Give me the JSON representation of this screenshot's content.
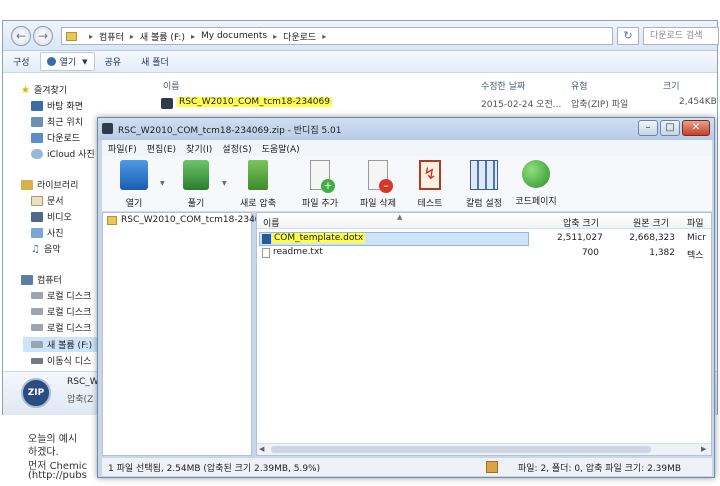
{
  "explorer": {
    "address": {
      "segments": [
        "컴퓨터",
        "새 볼륨 (F:)",
        "My documents",
        "다운로드"
      ]
    },
    "search_placeholder": "다운로드 검색",
    "toolbar": {
      "organize": "구성",
      "open": "열기",
      "share": "공유",
      "new_folder": "새 폴더"
    },
    "sidebar": {
      "favorites": "즐겨찾기",
      "fav_items": [
        "바탕 화면",
        "최근 위치",
        "다운로드",
        "iCloud 사진"
      ],
      "libraries": "라이브러리",
      "lib_items": [
        "문서",
        "비디오",
        "사진",
        "음악"
      ],
      "computer": "컴퓨터",
      "comp_items": [
        "로컬 디스크",
        "로컬 디스크",
        "로컬 디스크",
        "새 볼륨 (F:)",
        "이동식 디스"
      ]
    },
    "columns": {
      "name": "이름",
      "modified": "수정한 날짜",
      "type": "유형",
      "size": "크기"
    },
    "file": {
      "name": "RSC_W2010_COM_tcm18-234069",
      "modified": "2015-02-24 오전...",
      "type": "압축(ZIP) 파일",
      "size": "2,454KB"
    },
    "status": {
      "name": "RSC_W",
      "type": "압축(Z"
    }
  },
  "bandizip": {
    "title": "RSC_W2010_COM_tcm18-234069.zip - 반디집 5.01",
    "menu": [
      "파일(F)",
      "편집(E)",
      "찾기(I)",
      "설정(S)",
      "도움말(A)"
    ],
    "tools": [
      "열기",
      "풀기",
      "새로 압축",
      "파일 추가",
      "파일 삭제",
      "테스트",
      "칼럼 설정",
      "코드페이지"
    ],
    "tree_root": "RSC_W2010_COM_tcm18-2340",
    "list_columns": {
      "name": "이름",
      "packed": "압축 크기",
      "original": "원본 크기",
      "type": "파일"
    },
    "rows": [
      {
        "name": "COM_template.dotx",
        "packed": "2,511,027",
        "original": "2,668,323",
        "type": "Micr"
      },
      {
        "name": "readme.txt",
        "packed": "700",
        "original": "1,382",
        "type": "텍스"
      }
    ],
    "status_left": "1 파일 선택됨, 2.54MB (압축된 크기 2.39MB, 5.9%)",
    "status_right": "파일: 2, 폴더: 0, 압축 파일 크기: 2.39MB"
  },
  "document": {
    "lines": [
      "오늘의 예시",
      "하겠다.",
      "먼저 Chemic",
      "(http://pubs"
    ]
  },
  "colors": {
    "highlight": "#fdfd4a",
    "selection": "#cde3f7",
    "accent": "#3a6ea5"
  }
}
